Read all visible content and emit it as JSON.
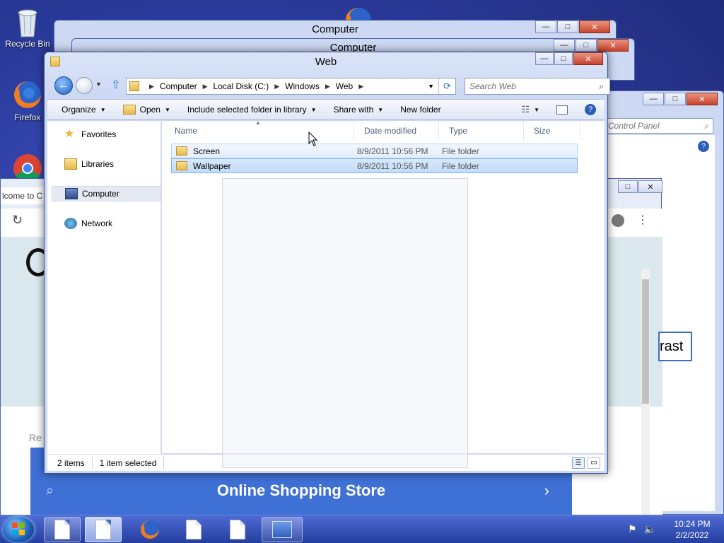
{
  "desktop": {
    "icons": [
      {
        "label": "Recycle Bin",
        "icon": "recycle-bin-icon"
      },
      {
        "label": "Firefox",
        "icon": "firefox-icon"
      },
      {
        "label": "",
        "icon": "chrome-icon"
      }
    ]
  },
  "background_windows": {
    "window1_title": "Computer",
    "window2_title": "Computer",
    "control_panel_search": "Control Panel",
    "browser_tab_fragment": "lcome to C",
    "contrast_fragment": "rast",
    "reload_fragment": "Re",
    "shopping_banner": "Online Shopping Store"
  },
  "explorer": {
    "title": "Web",
    "address": {
      "crumbs": [
        "Computer",
        "Local Disk (C:)",
        "Windows",
        "Web"
      ]
    },
    "search_placeholder": "Search Web",
    "toolbar": {
      "organize": "Organize",
      "open": "Open",
      "include_in_library": "Include selected folder in library",
      "share_with": "Share with",
      "new_folder": "New folder"
    },
    "nav": {
      "favorites": "Favorites",
      "libraries": "Libraries",
      "computer": "Computer",
      "network": "Network"
    },
    "columns": {
      "name": "Name",
      "date_modified": "Date modified",
      "type": "Type",
      "size": "Size"
    },
    "files": [
      {
        "name": "Screen",
        "date": "8/9/2011 10:56 PM",
        "type": "File folder",
        "state": "hover"
      },
      {
        "name": "Wallpaper",
        "date": "8/9/2011 10:56 PM",
        "type": "File folder",
        "state": "selected"
      }
    ],
    "status": {
      "item_count": "2 items",
      "selection": "1 item selected"
    }
  },
  "taskbar": {
    "time": "10:24 PM",
    "date": "2/2/2022"
  },
  "colors": {
    "desktop": "#2a3a9a",
    "selection": "#c0dcf8",
    "taskbar": "#233e9e",
    "banner": "#4a7be0"
  }
}
